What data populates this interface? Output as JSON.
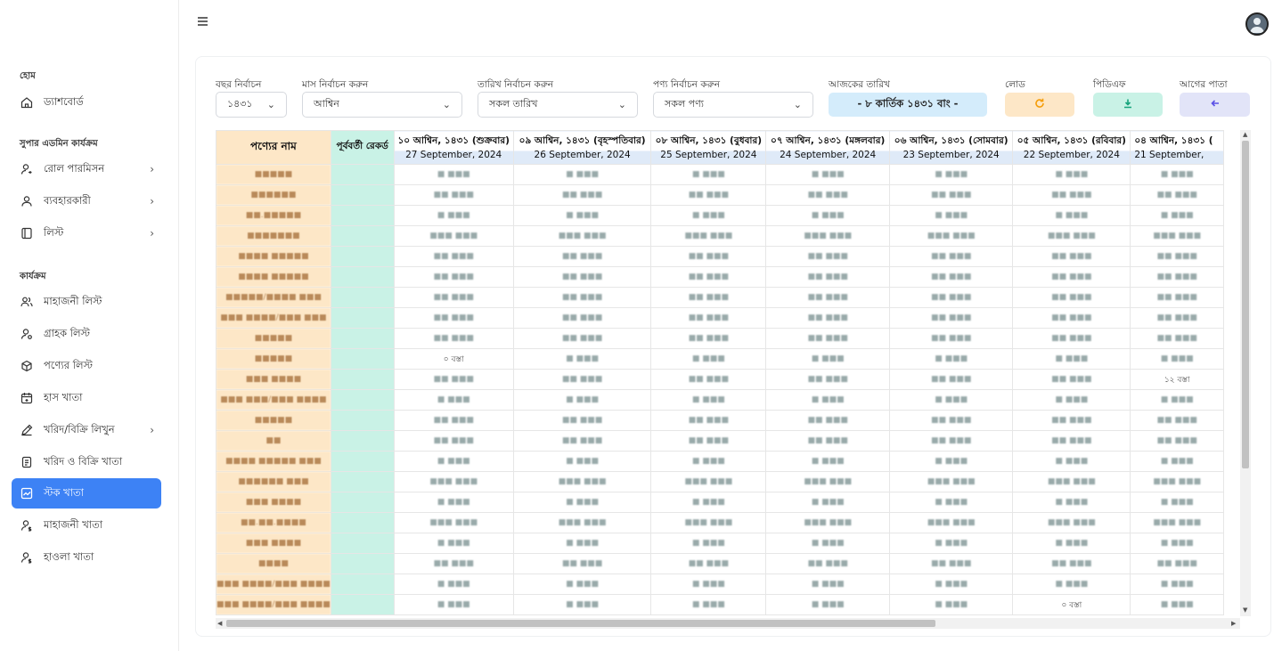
{
  "sidebar": {
    "home_section": "হোম",
    "dashboard": "ড্যাশবোর্ড",
    "admin_section": "সুপার এডমিন কার্যক্রম",
    "admin_items": [
      "রোল পারমিসন",
      "ব্যবহারকারী",
      "লিস্ট"
    ],
    "work_section": "কার্যক্রম",
    "work_items": [
      "মাহাজনী লিস্ট",
      "গ্রাহক লিস্ট",
      "পণ্যের লিস্ট",
      "হাস খাতা",
      "খরিদ/বিক্রি লিখুন",
      "খরিদ ও বিক্রি খাতা",
      "স্টক খাতা",
      "মাহাজনী খাতা",
      "হাওলা খাতা"
    ]
  },
  "filters": {
    "year_label": "বছর নির্বাচন",
    "year_value": "১৪৩১",
    "month_label": "মাস নির্বাচন করুন",
    "month_value": "আশ্বিন",
    "date_label": "তারিখ নির্বাচন করুন",
    "date_value": "সকল তারিখ",
    "product_label": "পণ্য নির্বাচন করুন",
    "product_value": "সকল পণ্য",
    "today_label": "আজকের তারিখ",
    "today_value": "- ৮ কার্তিক ১৪৩১ বাং -",
    "load_label": "লোড",
    "pdf_label": "পিডিএফ",
    "prev_label": "আগের পাতা"
  },
  "colors": {
    "load": "#fde7c7",
    "pdf": "#c9f2e6",
    "prev": "#e2e4f8",
    "today": "#d4ecfb",
    "active": "#3d82f5"
  },
  "table": {
    "col_name": "পণ্যের নাম",
    "col_prev": "পূর্ববর্তী রেকর্ড",
    "dates": [
      {
        "bn": "১০ আশ্বিন, ১৪৩১ (শুক্রবার)",
        "en": "27 September, 2024"
      },
      {
        "bn": "০৯ আশ্বিন, ১৪৩১ (বৃহস্পতিবার)",
        "en": "26 September, 2024"
      },
      {
        "bn": "০৮ আশ্বিন, ১৪৩১ (বুধবার)",
        "en": "25 September, 2024"
      },
      {
        "bn": "০৭ আশ্বিন, ১৪৩১ (মঙ্গলবার)",
        "en": "24 September, 2024"
      },
      {
        "bn": "০৬ আশ্বিন, ১৪৩১ (সোমবার)",
        "en": "23 September, 2024"
      },
      {
        "bn": "০৫ আশ্বিন, ১৪৩১ (রবিবার)",
        "en": "22 September, 2024"
      },
      {
        "bn": "০৪ আশ্বিন, ১৪৩১ (",
        "en": "21 September,"
      }
    ],
    "rows": [
      [
        "■■■■■",
        "■ ■■■",
        "■ ■■■",
        "■ ■■■",
        "■ ■■■",
        "■ ■■■",
        "■ ■■■",
        "■ ■■■"
      ],
      [
        "■■■■■■",
        "■■ ■■■",
        "■■ ■■■",
        "■■ ■■■",
        "■■ ■■■",
        "■■ ■■■",
        "■■ ■■■",
        "■■ ■■■"
      ],
      [
        "■■.■■■■■",
        "■ ■■■",
        "■ ■■■",
        "■ ■■■",
        "■ ■■■",
        "■ ■■■",
        "■ ■■■",
        "■ ■■■"
      ],
      [
        "■■■■■■■",
        "■■■ ■■■",
        "■■■ ■■■",
        "■■■ ■■■",
        "■■■ ■■■",
        "■■■ ■■■",
        "■■■ ■■■",
        "■■■ ■■■"
      ],
      [
        "■■■■ ■■■■■",
        "■■ ■■■",
        "■■ ■■■",
        "■■ ■■■",
        "■■ ■■■",
        "■■ ■■■",
        "■■ ■■■",
        "■■ ■■■"
      ],
      [
        "■■■■ ■■■■■",
        "■■ ■■■",
        "■■ ■■■",
        "■■ ■■■",
        "■■ ■■■",
        "■■ ■■■",
        "■■ ■■■",
        "■■ ■■■"
      ],
      [
        "■■■■■/■■■■ ■■■",
        "■■ ■■■",
        "■■ ■■■",
        "■■ ■■■",
        "■■ ■■■",
        "■■ ■■■",
        "■■ ■■■",
        "■■ ■■■"
      ],
      [
        "■■■ ■■■■/■■■ ■■■",
        "■■ ■■■",
        "■■ ■■■",
        "■■ ■■■",
        "■■ ■■■",
        "■■ ■■■",
        "■■ ■■■",
        "■■ ■■■"
      ],
      [
        "■■■■■",
        "■■ ■■■",
        "■■ ■■■",
        "■■ ■■■",
        "■■ ■■■",
        "■■ ■■■",
        "■■ ■■■",
        "■■ ■■■"
      ],
      [
        "■■■■■",
        "০ বস্তা",
        "■ ■■■",
        "■ ■■■",
        "■ ■■■",
        "■ ■■■",
        "■ ■■■",
        "■ ■■■"
      ],
      [
        "■■■ ■■■■",
        "■■ ■■■",
        "■■ ■■■",
        "■■ ■■■",
        "■■ ■■■",
        "■■ ■■■",
        "■■ ■■■",
        "১২ বস্তা"
      ],
      [
        "■■■ ■■■/■■■ ■■■■",
        "■ ■■■",
        "■ ■■■",
        "■ ■■■",
        "■ ■■■",
        "■ ■■■",
        "■ ■■■",
        "■ ■■■"
      ],
      [
        "■■■■■",
        "■■ ■■■",
        "■■ ■■■",
        "■■ ■■■",
        "■■ ■■■",
        "■■ ■■■",
        "■■ ■■■",
        "■■ ■■■"
      ],
      [
        "■■",
        "■■ ■■■",
        "■■ ■■■",
        "■■ ■■■",
        "■■ ■■■",
        "■■ ■■■",
        "■■ ■■■",
        "■■ ■■■"
      ],
      [
        "■■■■ ■■■■■ ■■■",
        "■ ■■■",
        "■ ■■■",
        "■ ■■■",
        "■ ■■■",
        "■ ■■■",
        "■ ■■■",
        "■ ■■■"
      ],
      [
        "■■■■■■ ■■■",
        "■■■ ■■■",
        "■■■ ■■■",
        "■■■ ■■■",
        "■■■ ■■■",
        "■■■ ■■■",
        "■■■ ■■■",
        "■■■ ■■■"
      ],
      [
        "■■■ ■■■■",
        "■ ■■■",
        "■ ■■■",
        "■ ■■■",
        "■ ■■■",
        "■ ■■■",
        "■ ■■■",
        "■ ■■■"
      ],
      [
        "■■.■■.■■■■",
        "■■■ ■■■",
        "■■■ ■■■",
        "■■■ ■■■",
        "■■■ ■■■",
        "■■■ ■■■",
        "■■■ ■■■",
        "■■■ ■■■"
      ],
      [
        "■■■ ■■■■",
        "■ ■■■",
        "■ ■■■",
        "■ ■■■",
        "■ ■■■",
        "■ ■■■",
        "■ ■■■",
        "■ ■■■"
      ],
      [
        "■■■■",
        "■■ ■■■",
        "■■ ■■■",
        "■■ ■■■",
        "■■ ■■■",
        "■■ ■■■",
        "■■ ■■■",
        "■■ ■■■"
      ],
      [
        "■■■ ■■■■/■■■ ■■■■",
        "■ ■■■",
        "■ ■■■",
        "■ ■■■",
        "■ ■■■",
        "■ ■■■",
        "■ ■■■",
        "■ ■■■"
      ],
      [
        "■■■ ■■■■/■■■ ■■■■",
        "■ ■■■",
        "■ ■■■",
        "■ ■■■",
        "■ ■■■",
        "■ ■■■",
        "০ বস্তা",
        "■ ■■■"
      ]
    ]
  }
}
